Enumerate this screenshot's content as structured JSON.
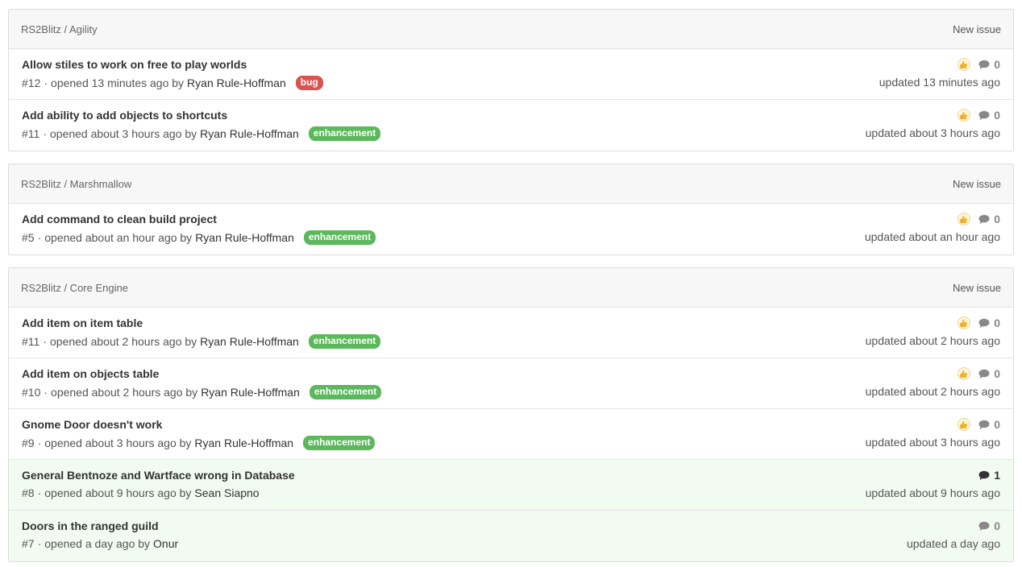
{
  "groups": [
    {
      "repo": "RS2Blitz / Agility",
      "new_issue": "New issue",
      "issues": [
        {
          "title": "Allow stiles to work on free to play worlds",
          "number": "#12",
          "opened": "opened 13 minutes ago by",
          "author": "Ryan Rule-Hoffman",
          "label": "bug",
          "comments": "0",
          "updated": "updated 13 minutes ago"
        },
        {
          "title": "Add ability to add objects to shortcuts",
          "number": "#11",
          "opened": "opened about 3 hours ago by",
          "author": "Ryan Rule-Hoffman",
          "label": "enhancement",
          "comments": "0",
          "updated": "updated about 3 hours ago"
        }
      ]
    },
    {
      "repo": "RS2Blitz / Marshmallow",
      "new_issue": "New issue",
      "issues": [
        {
          "title": "Add command to clean build project",
          "number": "#5",
          "opened": "opened about an hour ago by",
          "author": "Ryan Rule-Hoffman",
          "label": "enhancement",
          "comments": "0",
          "updated": "updated about an hour ago"
        }
      ]
    },
    {
      "repo": "RS2Blitz / Core Engine",
      "new_issue": "New issue",
      "issues": [
        {
          "title": "Add item on item table",
          "number": "#11",
          "opened": "opened about 2 hours ago by",
          "author": "Ryan Rule-Hoffman",
          "label": "enhancement",
          "comments": "0",
          "updated": "updated about 2 hours ago"
        },
        {
          "title": "Add item on objects table",
          "number": "#10",
          "opened": "opened about 2 hours ago by",
          "author": "Ryan Rule-Hoffman",
          "label": "enhancement",
          "comments": "0",
          "updated": "updated about 2 hours ago"
        },
        {
          "title": "Gnome Door doesn't work",
          "number": "#9",
          "opened": "opened about 3 hours ago by",
          "author": "Ryan Rule-Hoffman",
          "label": "enhancement",
          "comments": "0",
          "updated": "updated about 3 hours ago"
        },
        {
          "title": "General Bentnoze and Wartface wrong in Database",
          "number": "#8",
          "opened": "opened about 9 hours ago by",
          "author": "Sean Siapno",
          "label": "",
          "comments": "1",
          "updated": "updated about 9 hours ago"
        },
        {
          "title": "Doors in the ranged guild",
          "number": "#7",
          "opened": "opened a day ago by",
          "author": "Onur",
          "label": "",
          "comments": "0",
          "updated": "updated a day ago"
        }
      ]
    }
  ],
  "separator": "·",
  "colors": {
    "bug": "#d9534f",
    "enhancement": "#5cb85c",
    "highlight_row": "#f1fbf1"
  },
  "icons": {
    "thumb": "thumbs-up-icon",
    "comment": "comment-icon"
  }
}
